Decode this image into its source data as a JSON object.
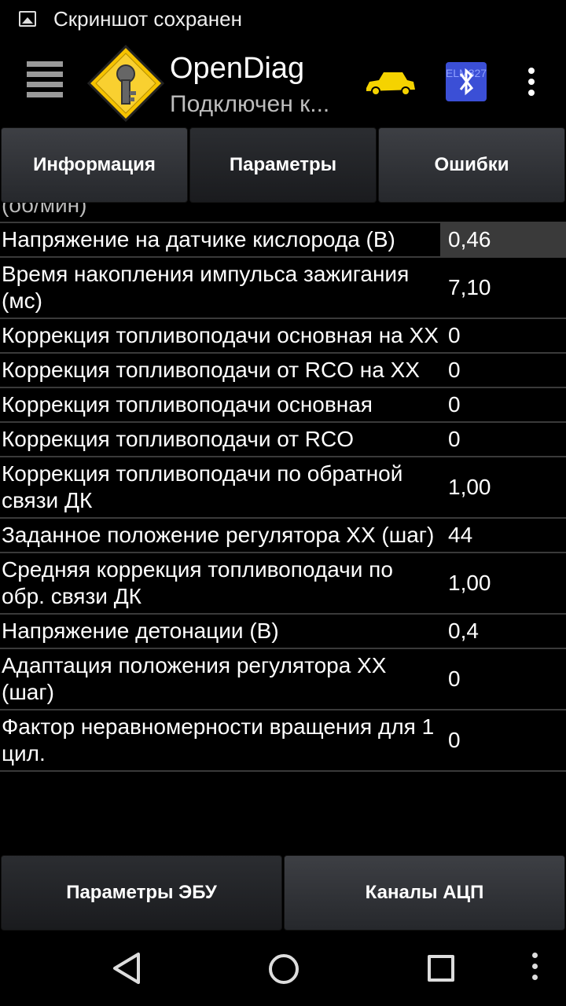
{
  "status_bar": {
    "notification": "Скриншот сохранен"
  },
  "app_bar": {
    "title": "OpenDiag",
    "subtitle": "Подключен к...",
    "bt_label": "ELM327"
  },
  "tabs": [
    {
      "label": "Информация"
    },
    {
      "label": "Параметры"
    },
    {
      "label": "Ошибки"
    }
  ],
  "params": {
    "cut_row": "(об/мин)",
    "rows": [
      {
        "label": "Напряжение на датчике кислорода (В)",
        "value": "0,46"
      },
      {
        "label": "Время накопления импульса зажигания (мс)",
        "value": "7,10"
      },
      {
        "label": "Коррекция топливоподачи основная на ХХ",
        "value": "0"
      },
      {
        "label": "Коррекция топливоподачи от RCO на ХХ",
        "value": "0"
      },
      {
        "label": "Коррекция топливоподачи основная",
        "value": "0"
      },
      {
        "label": "Коррекция топливоподачи от RCO",
        "value": "0"
      },
      {
        "label": "Коррекция топливоподачи по обратной связи ДК",
        "value": "1,00"
      },
      {
        "label": "Заданное положение регулятора ХХ (шаг)",
        "value": "44"
      },
      {
        "label": "Средняя коррекция топливоподачи по обр. связи ДК",
        "value": "1,00"
      },
      {
        "label": "Напряжение детонации (В)",
        "value": "0,4"
      },
      {
        "label": "Адаптация положения регулятора ХХ (шаг)",
        "value": "0"
      },
      {
        "label": "Фактор неравномерности вращения для 1 цил.",
        "value": "0"
      }
    ]
  },
  "bottom_buttons": [
    {
      "label": "Параметры ЭБУ"
    },
    {
      "label": "Каналы АЦП"
    }
  ],
  "colors": {
    "car": "#f5d300",
    "bluetooth": "#3b4fd6"
  }
}
